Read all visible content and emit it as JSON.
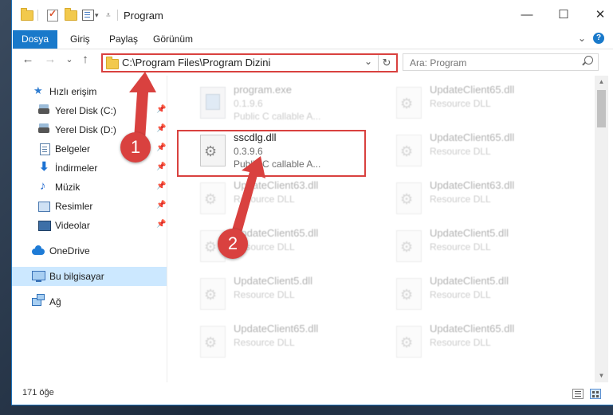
{
  "window": {
    "title": "Program",
    "controls": {
      "minimize": "—",
      "maximize": "☐",
      "close": "✕"
    }
  },
  "ribbon": {
    "file_tab": "Dosya",
    "tabs": [
      "Giriş",
      "Paylaş",
      "Görünüm"
    ],
    "expand_icon": "chevron-down-icon",
    "help_icon": "?"
  },
  "address": {
    "path": "C:\\Program Files\\Program Dizini",
    "dropdown_icon": "⌄",
    "refresh_icon": "↻"
  },
  "nav_buttons": {
    "back": "←",
    "forward": "→",
    "recent": "⌄",
    "up": "↑"
  },
  "search": {
    "placeholder": "Ara: Program"
  },
  "sidebar": {
    "items": [
      {
        "label": "Hızlı erişim",
        "icon": "star-icon",
        "pinned": false
      },
      {
        "label": "Yerel Disk (C:)",
        "icon": "drive-icon",
        "pinned": true
      },
      {
        "label": "Yerel Disk (D:)",
        "icon": "drive-icon",
        "pinned": true
      },
      {
        "label": "Belgeler",
        "icon": "documents-icon",
        "pinned": true
      },
      {
        "label": "İndirmeler",
        "icon": "download-icon",
        "pinned": true
      },
      {
        "label": "Müzik",
        "icon": "music-icon",
        "pinned": true
      },
      {
        "label": "Resimler",
        "icon": "pictures-icon",
        "pinned": true
      },
      {
        "label": "Videolar",
        "icon": "videos-icon",
        "pinned": true
      },
      {
        "label": "OneDrive",
        "icon": "cloud-icon",
        "pinned": false
      },
      {
        "label": "Bu bilgisayar",
        "icon": "computer-icon",
        "pinned": false,
        "selected": true
      },
      {
        "label": "Ağ",
        "icon": "network-icon",
        "pinned": false
      }
    ]
  },
  "files": [
    {
      "name": "program.exe",
      "line2": "0.1.9.6",
      "line3": "Public C callable A...",
      "faded": true,
      "type": "exe"
    },
    {
      "name": "UpdateClient65.dll",
      "line2": "Resource DLL",
      "line3": "",
      "faded": true,
      "type": "dll"
    },
    {
      "name": "sscdlg.dll",
      "line2": "0.3.9.6",
      "line3": "Public C callable A...",
      "faded": false,
      "type": "dll",
      "highlighted": true
    },
    {
      "name": "UpdateClient65.dll",
      "line2": "Resource DLL",
      "line3": "",
      "faded": true,
      "type": "dll"
    },
    {
      "name": "UpdateClient63.dll",
      "line2": "Resource DLL",
      "line3": "",
      "faded": true,
      "type": "dll"
    },
    {
      "name": "UpdateClient63.dll",
      "line2": "Resource DLL",
      "line3": "",
      "faded": true,
      "type": "dll"
    },
    {
      "name": "UpdateClient65.dll",
      "line2": "Resource DLL",
      "line3": "",
      "faded": true,
      "type": "dll"
    },
    {
      "name": "UpdateClient5.dll",
      "line2": "Resource DLL",
      "line3": "",
      "faded": true,
      "type": "dll"
    },
    {
      "name": "UpdateClient5.dll",
      "line2": "Resource DLL",
      "line3": "",
      "faded": true,
      "type": "dll"
    },
    {
      "name": "UpdateClient5.dll",
      "line2": "Resource DLL",
      "line3": "",
      "faded": true,
      "type": "dll"
    },
    {
      "name": "UpdateClient65.dll",
      "line2": "Resource DLL",
      "line3": "",
      "faded": true,
      "type": "dll"
    },
    {
      "name": "UpdateClient65.dll",
      "line2": "Resource DLL",
      "line3": "",
      "faded": true,
      "type": "dll"
    }
  ],
  "status": {
    "item_count": "171 öğe"
  },
  "annotations": {
    "step1": "1",
    "step2": "2",
    "accent_color": "#d9413f"
  }
}
